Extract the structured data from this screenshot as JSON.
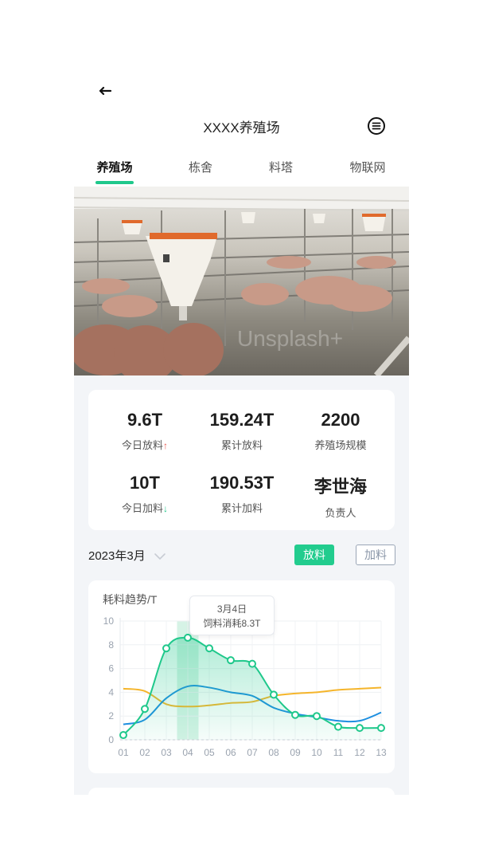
{
  "header": {
    "title": "XXXX养殖场",
    "back_icon": "back-arrow-icon",
    "menu_icon": "menu-circle-icon"
  },
  "tabs": [
    {
      "label": "养殖场",
      "active": true
    },
    {
      "label": "栋舍",
      "active": false
    },
    {
      "label": "料塔",
      "active": false
    },
    {
      "label": "物联网",
      "active": false
    }
  ],
  "hero": {
    "watermark": "Unsplash+"
  },
  "stats": [
    {
      "value": "9.6T",
      "label": "今日放料",
      "trend": "up"
    },
    {
      "value": "159.24T",
      "label": "累计放料"
    },
    {
      "value": "2200",
      "label": "养殖场规模"
    },
    {
      "value": "10T",
      "label": "今日加料",
      "trend": "down"
    },
    {
      "value": "190.53T",
      "label": "累计加料"
    },
    {
      "value": "李世海",
      "label": "负责人"
    }
  ],
  "filters": {
    "date": "2023年3月",
    "feed_button": "放料",
    "add_button": "加料"
  },
  "colors": {
    "accent": "#22cc8e",
    "trend_up": "#e8584f",
    "series_blue": "#1e8fe0",
    "series_orange": "#f5b52b"
  },
  "chart_data": {
    "type": "line",
    "title": "耗料趋势/T",
    "categories": [
      "01",
      "02",
      "03",
      "04",
      "05",
      "06",
      "07",
      "08",
      "09",
      "10",
      "11",
      "12",
      "13"
    ],
    "ylim": [
      0,
      10
    ],
    "yticks": [
      "0",
      "2",
      "4",
      "6",
      "8",
      "10"
    ],
    "grid": true,
    "series": [
      {
        "color": "#1fc88b",
        "values": [
          0.4,
          2.6,
          7.7,
          8.6,
          7.7,
          6.7,
          6.4,
          3.8,
          2.1,
          2.0,
          1.1,
          1.0,
          1.0
        ],
        "area": true,
        "markers": true
      },
      {
        "color": "#1e8fe0",
        "values": [
          1.3,
          1.7,
          3.5,
          4.5,
          4.4,
          4.0,
          3.7,
          2.7,
          2.2,
          1.9,
          1.6,
          1.6,
          2.3
        ]
      },
      {
        "color": "#f5b52b",
        "values": [
          4.3,
          4.1,
          3.0,
          2.8,
          2.9,
          3.1,
          3.2,
          3.7,
          3.9,
          4.0,
          4.2,
          4.3,
          4.4
        ]
      }
    ],
    "highlight_index": 3,
    "tooltip": {
      "line1": "3月4日",
      "line2": "饲料消耗8.3T"
    }
  }
}
